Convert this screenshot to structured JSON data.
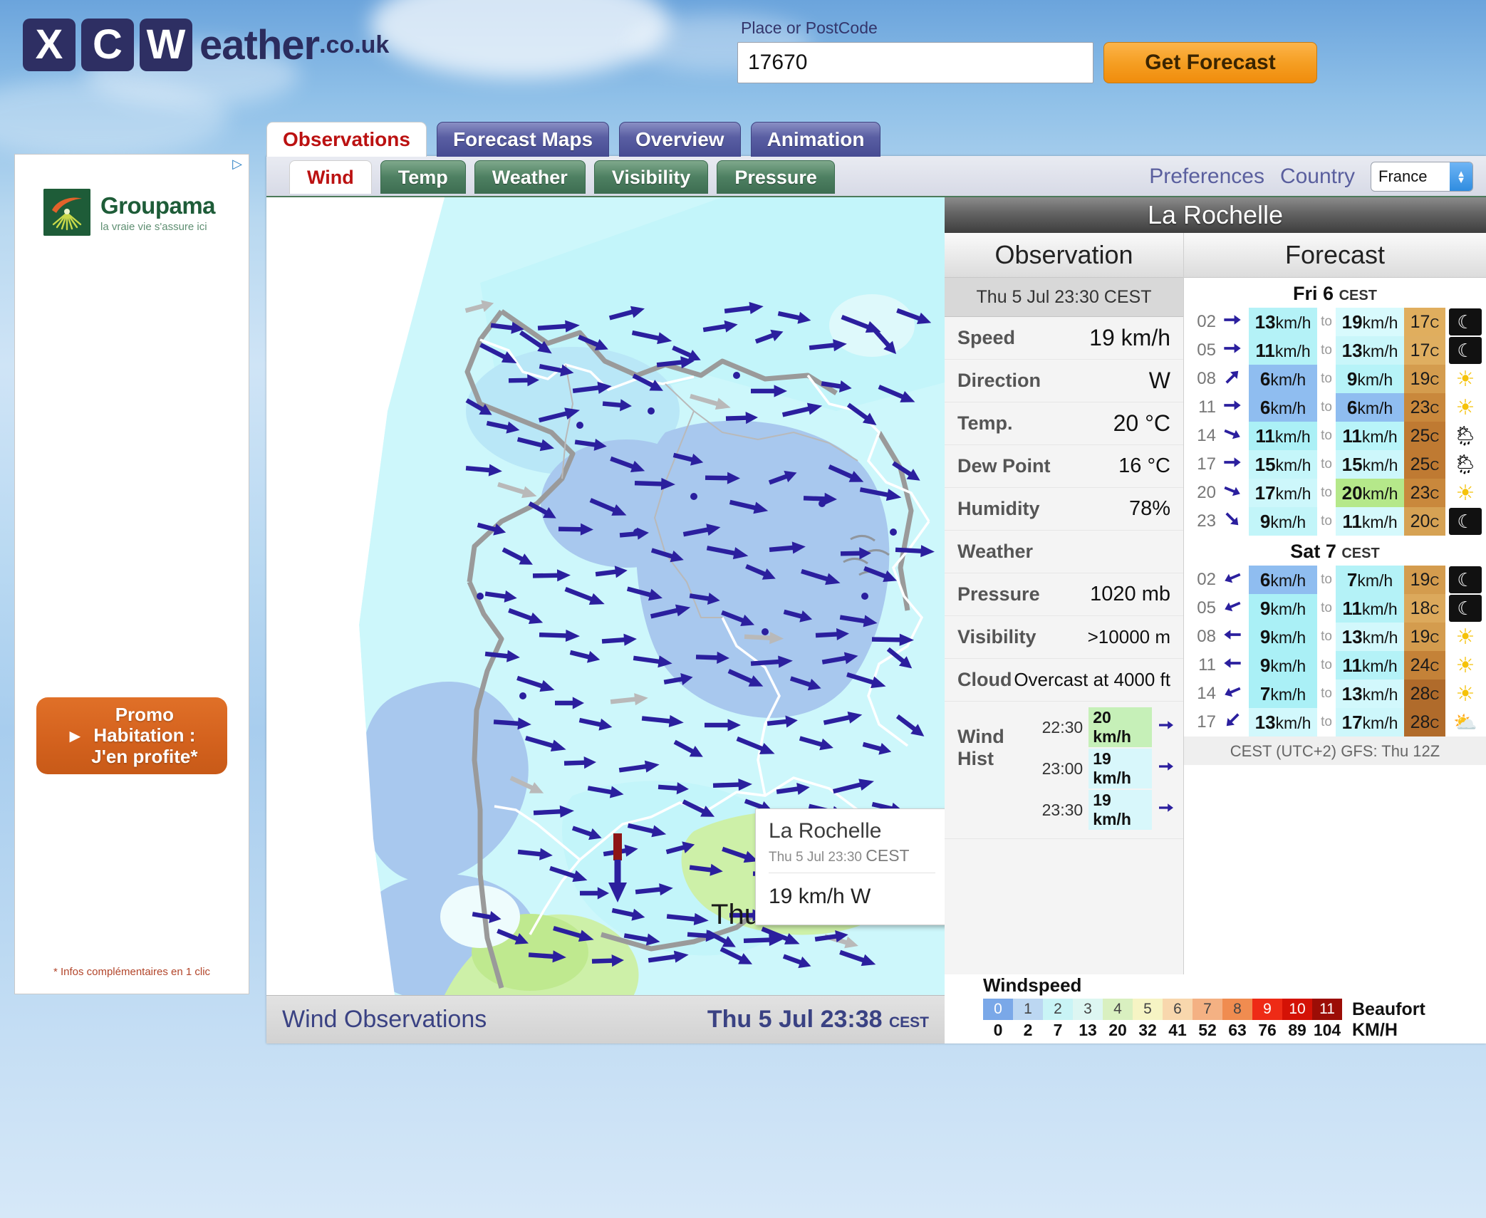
{
  "site": {
    "logo_letters": [
      "X",
      "C",
      "W"
    ],
    "logo_word": "eather",
    "logo_tld": ".co.uk"
  },
  "search": {
    "label": "Place or PostCode",
    "value": "17670",
    "placeholder": "Place or PostCode",
    "button_label": "Get Forecast"
  },
  "tabs": [
    {
      "label": "Observations",
      "active": true
    },
    {
      "label": "Forecast Maps",
      "active": false
    },
    {
      "label": "Overview",
      "active": false
    },
    {
      "label": "Animation",
      "active": false
    }
  ],
  "subtabs": [
    {
      "label": "Wind",
      "active": true
    },
    {
      "label": "Temp",
      "active": false
    },
    {
      "label": "Weather",
      "active": false
    },
    {
      "label": "Visibility",
      "active": false
    },
    {
      "label": "Pressure",
      "active": false
    }
  ],
  "prefs": {
    "preferences_label": "Preferences",
    "country_label": "Country",
    "country_value": "France"
  },
  "map": {
    "timestamp": "Thu 5  23:38",
    "timestamp_tz": "CEST",
    "footer_left": "Wind Observations",
    "footer_right": "Thu 5 Jul 23:38",
    "footer_right_tz": "CEST"
  },
  "tooltip": {
    "title": "La Rochelle",
    "time": "Thu 5 Jul 23:30",
    "time_tz": "CEST",
    "value": "19 km/h W"
  },
  "location": {
    "title": "La Rochelle"
  },
  "observation": {
    "header": "Observation",
    "date": "Thu 5 Jul 23:30 CEST",
    "rows": [
      {
        "key": "Speed",
        "value": "19 km/h"
      },
      {
        "key": "Direction",
        "value": "W"
      },
      {
        "key": "Temp.",
        "value": "20 °C"
      },
      {
        "key": "Dew Point",
        "value": "16 °C"
      },
      {
        "key": "Humidity",
        "value": "78%"
      },
      {
        "key": "Weather",
        "value": ""
      },
      {
        "key": "Pressure",
        "value": "1020 mb"
      },
      {
        "key": "Visibility",
        "value": ">10000 m"
      },
      {
        "key": "Cloud",
        "value": "Overcast at 4000 ft"
      }
    ],
    "wind_hist_label": "Wind Hist",
    "wind_hist": [
      {
        "time": "22:30",
        "speed": "20 km/h",
        "dir_deg": 90,
        "bg": "#c6f0b8"
      },
      {
        "time": "23:00",
        "speed": "19 km/h",
        "dir_deg": 90,
        "bg": "#d8f7fb"
      },
      {
        "time": "23:30",
        "speed": "19 km/h",
        "dir_deg": 90,
        "bg": "#d8f7fb"
      }
    ]
  },
  "forecast": {
    "header": "Forecast",
    "note": "CEST (UTC+2) GFS: Thu 12Z",
    "days": [
      {
        "day": "Fri 6",
        "tz": "CEST",
        "rows": [
          {
            "hour": "02",
            "dir_deg": 90,
            "min": "13",
            "max": "19",
            "min_bg": "#b4f2f7",
            "max_bg": "#d8fafd",
            "temp": "17",
            "temp_bg": "#e0ae5e",
            "icon": "moon"
          },
          {
            "hour": "05",
            "dir_deg": 90,
            "min": "11",
            "max": "13",
            "min_bg": "#b4f2f7",
            "max_bg": "#c9f6fa",
            "temp": "17",
            "temp_bg": "#dfae60",
            "icon": "moon"
          },
          {
            "hour": "08",
            "dir_deg": 45,
            "min": "6",
            "max": "9",
            "min_bg": "#8fbdf0",
            "max_bg": "#b6f3f8",
            "temp": "19",
            "temp_bg": "#d49c4e",
            "icon": "sun"
          },
          {
            "hour": "11",
            "dir_deg": 90,
            "min": "6",
            "max": "6",
            "min_bg": "#8fbdf0",
            "max_bg": "#8fbdf0",
            "temp": "23",
            "temp_bg": "#c9883c",
            "icon": "sun"
          },
          {
            "hour": "14",
            "dir_deg": 112,
            "min": "11",
            "max": "11",
            "min_bg": "#abf0f6",
            "max_bg": "#b8f4f9",
            "temp": "25",
            "temp_bg": "#bf7a32",
            "icon": "partly-rain"
          },
          {
            "hour": "17",
            "dir_deg": 90,
            "min": "15",
            "max": "15",
            "min_bg": "#c5f6fa",
            "max_bg": "#cdf7fb",
            "temp": "25",
            "temp_bg": "#bf7a32",
            "icon": "partly-rain"
          },
          {
            "hour": "20",
            "dir_deg": 112,
            "min": "17",
            "max": "20",
            "min_bg": "#cdf7fb",
            "max_bg": "#b5e88a",
            "temp": "23",
            "temp_bg": "#c9883c",
            "icon": "sun"
          },
          {
            "hour": "23",
            "dir_deg": 135,
            "min": "9",
            "max": "11",
            "min_bg": "#c2f5f9",
            "max_bg": "#d5f9fc",
            "temp": "20",
            "temp_bg": "#d6a254",
            "icon": "moon"
          }
        ]
      },
      {
        "day": "Sat 7",
        "tz": "CEST",
        "rows": [
          {
            "hour": "02",
            "dir_deg": 247,
            "min": "6",
            "max": "7",
            "min_bg": "#8fbdf0",
            "max_bg": "#b4f2f7",
            "temp": "19",
            "temp_bg": "#d49c4e",
            "icon": "moon"
          },
          {
            "hour": "05",
            "dir_deg": 247,
            "min": "9",
            "max": "11",
            "min_bg": "#aaf0f6",
            "max_bg": "#b4f2f7",
            "temp": "18",
            "temp_bg": "#dca95c",
            "icon": "moon"
          },
          {
            "hour": "08",
            "dir_deg": 270,
            "min": "9",
            "max": "13",
            "min_bg": "#aaf0f6",
            "max_bg": "#d2f8fc",
            "temp": "19",
            "temp_bg": "#d49c4e",
            "icon": "sun"
          },
          {
            "hour": "11",
            "dir_deg": 270,
            "min": "9",
            "max": "11",
            "min_bg": "#aaf0f6",
            "max_bg": "#b4f2f7",
            "temp": "24",
            "temp_bg": "#c48238",
            "icon": "sun"
          },
          {
            "hour": "14",
            "dir_deg": 247,
            "min": "7",
            "max": "13",
            "min_bg": "#aaf0f6",
            "max_bg": "#d2f8fc",
            "temp": "28",
            "temp_bg": "#b06b2b",
            "icon": "sun"
          },
          {
            "hour": "17",
            "dir_deg": 225,
            "min": "13",
            "max": "17",
            "min_bg": "#d2f8fc",
            "max_bg": "#cdf7fb",
            "temp": "28",
            "temp_bg": "#b06b2b",
            "icon": "partly"
          }
        ]
      }
    ]
  },
  "legend": {
    "title": "Windspeed",
    "beaufort_label": "Beaufort",
    "kmh_label": "KM/H",
    "beaufort": [
      "0",
      "1",
      "2",
      "3",
      "4",
      "5",
      "6",
      "7",
      "8",
      "9",
      "10",
      "11"
    ],
    "kmh": [
      "0",
      "2",
      "7",
      "13",
      "20",
      "32",
      "41",
      "52",
      "63",
      "76",
      "89",
      "104"
    ],
    "colors": [
      "#7aa8e8",
      "#bcd7f2",
      "#c9f4f6",
      "#ddf6f2",
      "#d9f0c0",
      "#f6f4c4",
      "#f8d7ad",
      "#f4b183",
      "#f08c50",
      "#ee2b16",
      "#d41206",
      "#9c0d06"
    ],
    "text_colors": [
      "#fff",
      "#444",
      "#444",
      "#444",
      "#444",
      "#444",
      "#444",
      "#444",
      "#444",
      "#fff",
      "#fff",
      "#fff"
    ]
  },
  "ad": {
    "brand": "Groupama",
    "tagline": "la vraie vie s'assure ici",
    "cta": "Promo\nHabitation :\nJ'en profite*",
    "footnote": "* Infos complémentaires en 1 clic"
  },
  "chart_data": {
    "type": "map",
    "title": "Wind Observations",
    "region": "France",
    "station_highlight": "La Rochelle",
    "station_value": "19 km/h W",
    "units": "km/h",
    "legend_scale_beaufort": [
      0,
      1,
      2,
      3,
      4,
      5,
      6,
      7,
      8,
      9,
      10,
      11
    ],
    "legend_scale_kmh": [
      0,
      2,
      7,
      13,
      20,
      32,
      41,
      52,
      63,
      76,
      89,
      104
    ]
  }
}
